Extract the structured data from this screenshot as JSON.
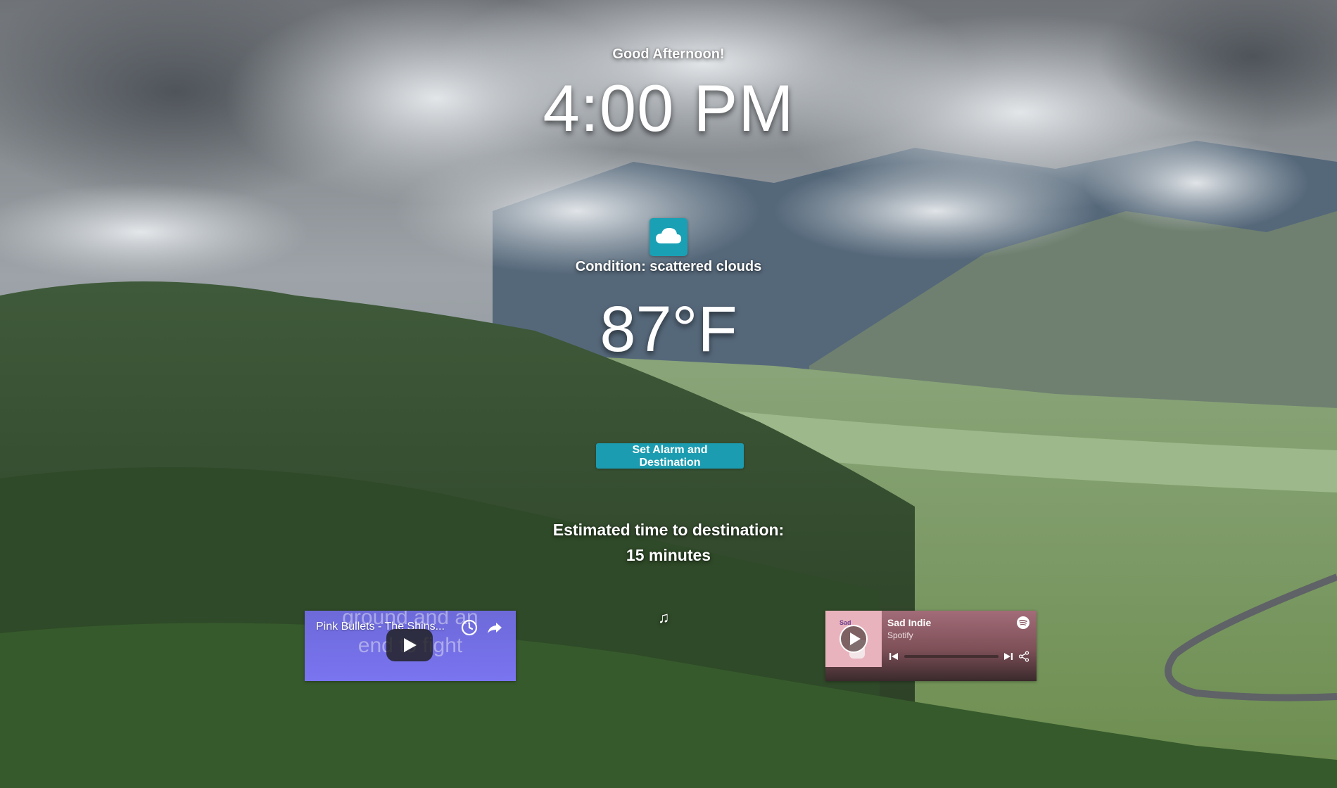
{
  "header": {
    "greeting": "Good Afternoon!",
    "time": "4:00 PM"
  },
  "weather": {
    "icon": "cloud-icon",
    "condition": "Condition: scattered clouds",
    "temperature": "87°F"
  },
  "actions": {
    "alarm_button_label": "Set Alarm and Destination"
  },
  "commute": {
    "eta_label": "Estimated time to destination:",
    "eta_value": "15 minutes"
  },
  "music": {
    "note_icon": "music-note-icon",
    "note_glyph": "♫"
  },
  "youtube": {
    "title": "Pink Bullets - The Shins...",
    "lyrics_line_1": "ground and an",
    "lyrics_line_2": "end to fight",
    "icons": [
      "watch-later-icon",
      "share-icon",
      "play-icon"
    ]
  },
  "spotify": {
    "playlist_title": "Sad Indie",
    "subtitle": "Spotify",
    "art_text": "Sad",
    "progress": 0,
    "icons": [
      "spotify-logo-icon",
      "play-icon",
      "previous-track-icon",
      "next-track-icon",
      "share-icon"
    ]
  },
  "colors": {
    "accent": "#1b9cb0",
    "youtube_bg": "#7a74f0",
    "spotify_bg": "#a26c78"
  }
}
